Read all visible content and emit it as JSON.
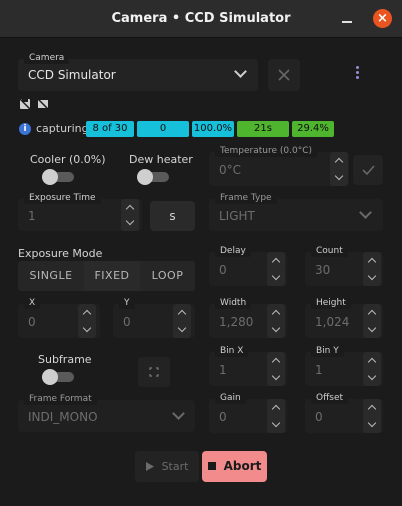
{
  "window": {
    "title": "Camera  •  CCD Simulator",
    "close_glyph": "×"
  },
  "camera": {
    "legend": "Camera",
    "selected": "CCD Simulator"
  },
  "status": {
    "text": "capturing",
    "frames": "8 of 30",
    "counter": "0",
    "progress": "100.0%",
    "time": "21s",
    "total_progress": "29.4%"
  },
  "cooler": {
    "label": "Cooler (0.0%)"
  },
  "dew_heater": {
    "label": "Dew heater"
  },
  "temperature": {
    "legend": "Temperature (0.0°C)",
    "placeholder": "0°C"
  },
  "exposure_time": {
    "legend": "Exposure Time",
    "value": "1",
    "unit": "s"
  },
  "frame_type": {
    "legend": "Frame Type",
    "value": "LIGHT"
  },
  "exposure_mode": {
    "label": "Exposure Mode",
    "options": [
      "SINGLE",
      "FIXED",
      "LOOP"
    ]
  },
  "delay": {
    "legend": "Delay",
    "value": "0"
  },
  "count": {
    "legend": "Count",
    "value": "30"
  },
  "x": {
    "legend": "X",
    "value": "0"
  },
  "y": {
    "legend": "Y",
    "value": "0"
  },
  "width": {
    "legend": "Width",
    "value": "1,280"
  },
  "height": {
    "legend": "Height",
    "value": "1,024"
  },
  "subframe": {
    "label": "Subframe"
  },
  "bin_x": {
    "legend": "Bin X",
    "value": "1"
  },
  "bin_y": {
    "legend": "Bin Y",
    "value": "1"
  },
  "frame_format": {
    "legend": "Frame Format",
    "value": "INDI_MONO"
  },
  "gain": {
    "legend": "Gain",
    "value": "0"
  },
  "offset": {
    "legend": "Offset",
    "value": "0"
  },
  "actions": {
    "start": "Start",
    "abort": "Abort"
  },
  "colors": {
    "accent_close": "#e95420",
    "badge_cyan": "#16c0db",
    "badge_green": "#4fb52e",
    "abort_bg": "#f28b8b"
  }
}
